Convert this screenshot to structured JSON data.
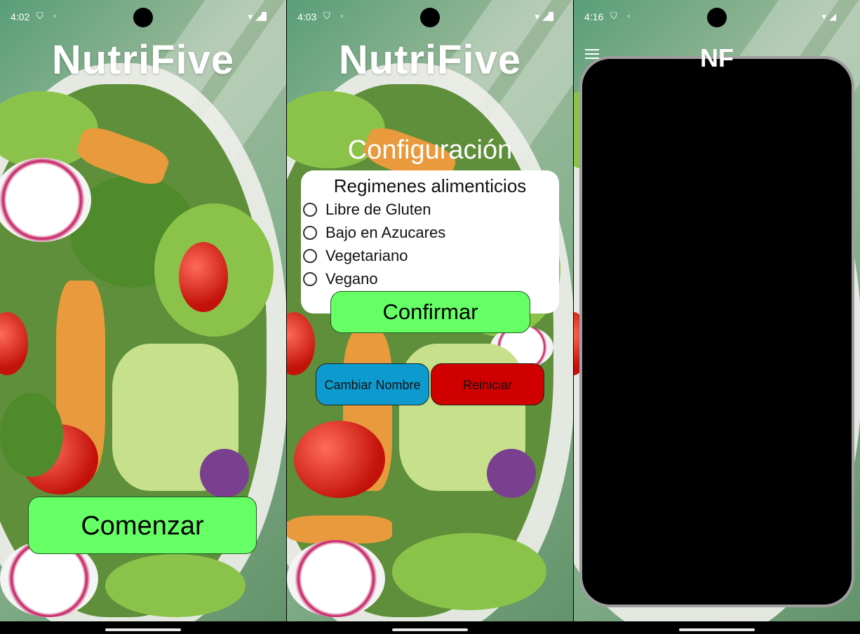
{
  "screen1": {
    "status": {
      "time": "4:02"
    },
    "app_title": "NutriFive",
    "start_button": "Comenzar"
  },
  "screen2": {
    "status": {
      "time": "4:03"
    },
    "app_title": "NutriFive",
    "config_title": "Configuración",
    "panel_heading": "Regimenes alimenticios",
    "options": [
      "Libre de Gluten",
      "Bajo en Azucares",
      "Vegetariano",
      "Vegano"
    ],
    "confirm_button": "Confirmar",
    "rename_button": "Cambiar Nombre",
    "reset_button": "Reiniciar"
  },
  "screen3": {
    "status": {
      "time": "4:16"
    },
    "app_title": "NF"
  },
  "colors": {
    "green_button": "#66ff66",
    "blue_button": "#0d9bcf",
    "red_button": "#d10000"
  }
}
